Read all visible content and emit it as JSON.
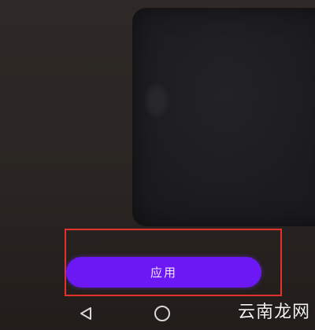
{
  "dialog": {
    "apply_label": "应用"
  },
  "colors": {
    "accent": "#6b18f5",
    "highlight": "#e5322d"
  },
  "nav": {
    "back_icon": "back-triangle-icon",
    "home_icon": "home-circle-icon"
  },
  "watermark": {
    "text": "云南龙网"
  }
}
